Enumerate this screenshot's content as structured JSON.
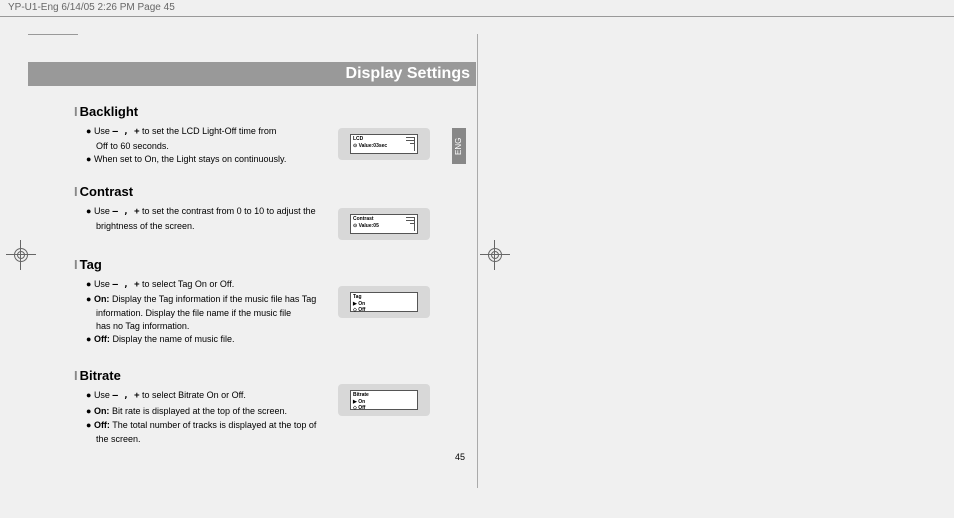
{
  "header_info": "YP-U1-Eng  6/14/05 2:26 PM  Page 45",
  "title": "Display Settings",
  "eng_tab": "ENG",
  "page_number": "45",
  "sections": {
    "backlight": {
      "heading": "Backlight",
      "items": [
        {
          "prefix": "Use ",
          "ctrl": "— , +",
          "suffix": " to set the LCD Light-Off time from"
        },
        {
          "cont": "Off to 60 seconds."
        },
        {
          "text": "When set to On, the Light stays on continuously."
        }
      ],
      "lcd": {
        "l1": "LCD",
        "l2": "⊙ Value:03sec"
      }
    },
    "contrast": {
      "heading": "Contrast",
      "items": [
        {
          "prefix": "Use ",
          "ctrl": "— , +",
          "suffix": " to set the contrast from 0 to 10 to adjust the"
        },
        {
          "cont": "brightness of the screen."
        }
      ],
      "lcd": {
        "l1": "Contrast",
        "l2": "⊙ Value:05"
      }
    },
    "tag": {
      "heading": "Tag",
      "items": [
        {
          "prefix": "Use ",
          "ctrl": "— , +",
          "suffix": " to select Tag On or Off."
        },
        {
          "label": "On:",
          "text": " Display the Tag information if the music file has Tag"
        },
        {
          "cont": "information. Display the file name if the music file"
        },
        {
          "cont": "has no Tag information."
        },
        {
          "label": "Off:",
          "text": " Display the name of music file."
        }
      ],
      "lcd": {
        "l1": "Tag",
        "l2": "▶ On",
        "l3": "◇ Off"
      }
    },
    "bitrate": {
      "heading": "Bitrate",
      "items": [
        {
          "prefix": "Use ",
          "ctrl": "— , +",
          "suffix": " to select Bitrate On or Off."
        },
        {
          "label": "On:",
          "text": " Bit rate is displayed at the top of the screen."
        },
        {
          "label": "Off:",
          "text": " The total number of tracks is displayed at the top of"
        },
        {
          "cont": "the screen."
        }
      ],
      "lcd": {
        "l1": "Bitrate",
        "l2": "▶ On",
        "l3": "◇ Off"
      }
    }
  }
}
